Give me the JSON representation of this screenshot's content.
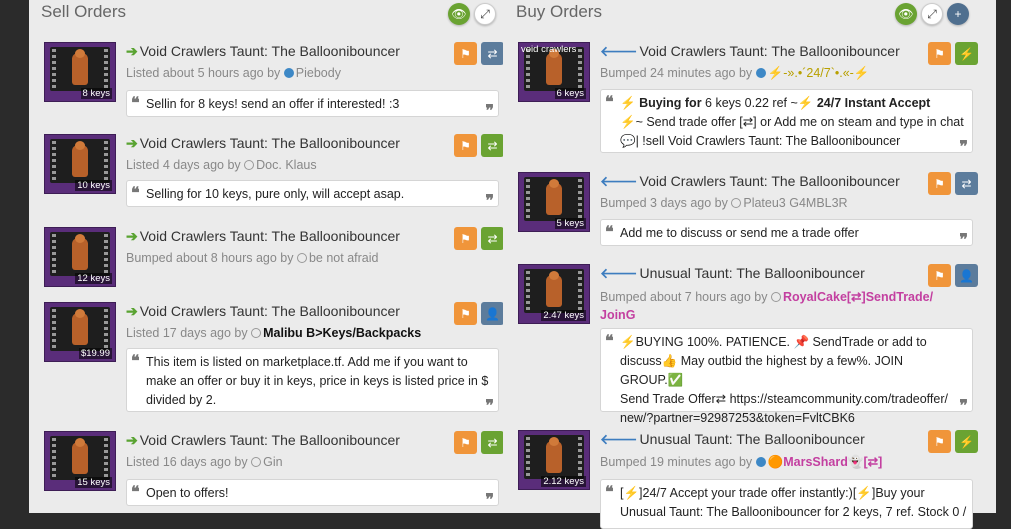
{
  "sell": {
    "title": "Sell Orders",
    "listings": [
      {
        "title": "Void Crawlers Taunt: The Balloonibouncer",
        "status": "Listed about 5 hours ago by",
        "user": "Piebody",
        "price": "8 keys",
        "comment": "Sellin for 8 keys! send an offer if interested! :3"
      },
      {
        "title": "Void Crawlers Taunt: The Balloonibouncer",
        "status": "Listed 4 days ago by",
        "user": "Doc. Klaus",
        "price": "10 keys",
        "comment": "Selling for 10 keys, pure only, will accept asap."
      },
      {
        "title": "Void Crawlers Taunt: The Balloonibouncer",
        "status": "Bumped about 8 hours ago by",
        "user": "be not afraid",
        "price": "12 keys",
        "comment": ""
      },
      {
        "title": "Void Crawlers Taunt: The Balloonibouncer",
        "status": "Listed 17 days ago by",
        "user": "Malibu B>Keys/Backpacks",
        "price": "$19.99",
        "comment": "This item is listed on marketplace.tf. Add me if you want to make an offer or buy it in keys, price in keys is listed price in $ divided by 2."
      },
      {
        "title": "Void Crawlers Taunt: The Balloonibouncer",
        "status": "Listed 16 days ago by",
        "user": "Gin",
        "price": "15 keys",
        "comment": "Open to offers!"
      }
    ]
  },
  "buy": {
    "title": "Buy Orders",
    "listings": [
      {
        "title": "Void Crawlers Taunt: The Balloonibouncer",
        "tag": "void crawlers",
        "status": "Bumped 24 minutes ago by",
        "user": "⚡-».•´24/7`•.«-⚡",
        "price": "6 keys",
        "comment_l1_icon": "⚡",
        "comment_l1_bold": "Buying for",
        "comment_l1": " 6 keys 0.22 ref ~⚡",
        "comment_l1_bold2": "24/7 Instant Accept",
        "comment_l2": "⚡~ Send trade offer [⇄] or Add me on steam and type in chat",
        "comment_l3": "💬| !sell Void Crawlers Taunt: The Balloonibouncer"
      },
      {
        "title": "Void Crawlers Taunt: The Balloonibouncer",
        "status": "Bumped 3 days ago by",
        "user": "Plateu3 G4MBL3R",
        "price": "5 keys",
        "comment": "Add me to discuss or send me a trade offer"
      },
      {
        "title": "Unusual Taunt: The Balloonibouncer",
        "status": "Bumped about 7 hours ago by",
        "user": "RoyalCake[⇄]SendTrade/",
        "user2": "JoinG",
        "price": "2.47 keys",
        "comment_l1": "⚡BUYING 100%. PATIENCE. 📌 SendTrade or add to",
        "comment_l2": "discuss👍 May outbid the highest by a few%. JOIN GROUP.✅",
        "comment_l3": "Send Trade Offer⇄ https://steamcommunity.com/tradeoffer/",
        "comment_l4": "new/?partner=92987253&token=FvltCBK6"
      },
      {
        "title": "Unusual Taunt: The Balloonibouncer",
        "status": "Bumped 19 minutes ago by",
        "user": "MarsShard",
        "user_suffix": "[⇄]",
        "price": "2.12 keys",
        "comment_l1": "[⚡]24/7 Accept your trade offer instantly:)[⚡]Buy your",
        "comment_l2": "Unusual Taunt: The Balloonibouncer for 2 keys, 7 ref. Stock 0 /"
      }
    ]
  },
  "icons": {
    "eye": "eye-icon",
    "expand": "expand-icon",
    "plus": "plus-icon",
    "flag": "flag-icon",
    "trade": "trade-icon",
    "bolt": "bolt-icon",
    "add_friend": "add-friend-icon",
    "quote": "quote-icon"
  }
}
